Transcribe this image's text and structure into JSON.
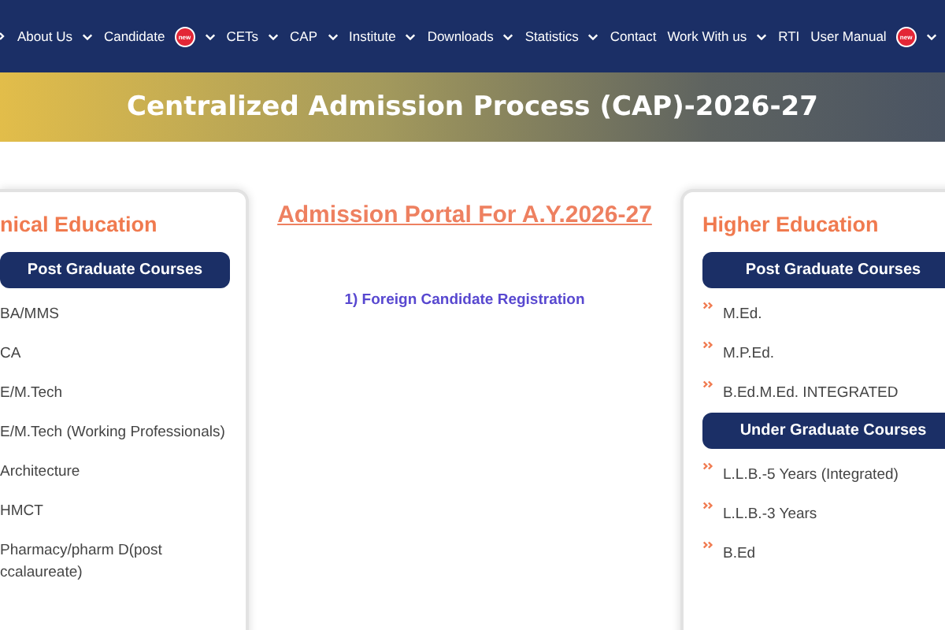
{
  "nav": {
    "items": [
      {
        "label": "About Us",
        "dropdown": true
      },
      {
        "label": "Candidate",
        "badge": "new",
        "dropdown": true
      },
      {
        "label": "CETs",
        "dropdown": true
      },
      {
        "label": "CAP",
        "dropdown": true
      },
      {
        "label": "Institute",
        "dropdown": true
      },
      {
        "label": "Downloads",
        "dropdown": true
      },
      {
        "label": "Statistics",
        "dropdown": true
      },
      {
        "label": "Contact",
        "dropdown": false
      },
      {
        "label": "Work With us",
        "dropdown": true
      },
      {
        "label": "RTI",
        "dropdown": false
      },
      {
        "label": "User Manual",
        "badge": "new",
        "dropdown": true
      }
    ]
  },
  "banner": {
    "title": "Centralized Admission Process (CAP)-2026-27"
  },
  "left_card": {
    "title": "nical Education",
    "sections": [
      {
        "title": "Post Graduate Courses",
        "items": [
          "BA/MMS",
          "CA",
          "E/M.Tech",
          "E/M.Tech (Working Professionals)",
          "Architecture",
          "HMCT",
          "Pharmacy/pharm D(post ccalaureate)"
        ]
      }
    ]
  },
  "center": {
    "title": "Admission Portal For A.Y.2026-27",
    "links": [
      "1) Foreign Candidate Registration"
    ]
  },
  "right_card": {
    "title": "Higher Education",
    "sections": [
      {
        "title": "Post Graduate Courses",
        "items": [
          "M.Ed.",
          "M.P.Ed.",
          "B.Ed.M.Ed. INTEGRATED"
        ]
      },
      {
        "title": "Under Graduate Courses",
        "items": [
          "L.L.B.-5 Years (Integrated)",
          "L.L.B.-3 Years",
          "B.Ed"
        ]
      }
    ]
  }
}
